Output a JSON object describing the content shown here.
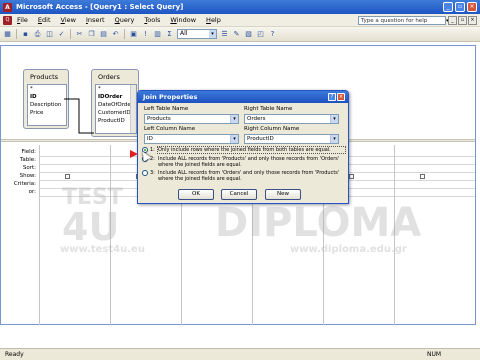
{
  "window": {
    "app_title": "Microsoft Access - [Query1 : Select Query]"
  },
  "menu": {
    "items": [
      "File",
      "Edit",
      "View",
      "Insert",
      "Query",
      "Tools",
      "Window",
      "Help"
    ],
    "help_placeholder": "Type a question for help"
  },
  "toolbar": {
    "combo_value": "All"
  },
  "tables": [
    {
      "name": "Products",
      "fields": [
        "*",
        "ID",
        "Description",
        "Price"
      ],
      "bold_field": 1
    },
    {
      "name": "Orders",
      "fields": [
        "*",
        "IDOrder",
        "DateOfOrde",
        "CustomerID",
        "ProductID"
      ],
      "bold_field": 1
    }
  ],
  "grid": {
    "row_labels": [
      "Field:",
      "Table:",
      "Sort:",
      "Show:",
      "Criteria:",
      "or:"
    ]
  },
  "dialog": {
    "title": "Join Properties",
    "left_table_label": "Left Table Name",
    "right_table_label": "Right Table Name",
    "left_table_value": "Products",
    "right_table_value": "Orders",
    "left_column_label": "Left Column Name",
    "right_column_label": "Right Column Name",
    "left_column_value": "ID",
    "right_column_value": "ProductID",
    "options": [
      {
        "num": "1:",
        "text": "Only include rows where the joined fields from both tables are equal.",
        "selected": true
      },
      {
        "num": "2:",
        "text": "Include ALL records from 'Products' and only those records from 'Orders' where the joined fields are equal.",
        "selected": false
      },
      {
        "num": "3:",
        "text": "Include ALL records from 'Orders' and only those records from 'Products' where the joined fields are equal.",
        "selected": false
      }
    ],
    "ok_label": "OK",
    "cancel_label": "Cancel",
    "new_label": "New"
  },
  "watermark": {
    "left_top": "TEST",
    "left_big": "4U",
    "right_big": "DIPLOMA",
    "left_url": "www.test4u.eu",
    "right_url": "www.diploma.edu.gr"
  },
  "status": {
    "left": "Ready",
    "num": "NUM"
  }
}
